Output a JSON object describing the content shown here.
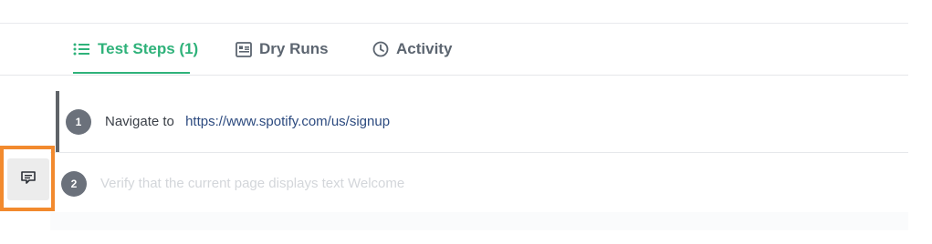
{
  "tabs": [
    {
      "label": "Test Steps (1)",
      "icon": "list-icon",
      "active": true
    },
    {
      "label": "Dry Runs",
      "icon": "document-list-icon",
      "active": false
    },
    {
      "label": "Activity",
      "icon": "clock-icon",
      "active": false
    }
  ],
  "steps": [
    {
      "number": "1",
      "action": "Navigate to",
      "target": "https://www.spotify.com/us/signup"
    },
    {
      "number": "2",
      "action": "Verify that the current page displays text Welcome"
    }
  ],
  "comment_button": {
    "icon": "comment-icon"
  },
  "colors": {
    "accent": "#2fb27a",
    "highlight": "#f28a2e",
    "link": "#2c4a7f"
  }
}
